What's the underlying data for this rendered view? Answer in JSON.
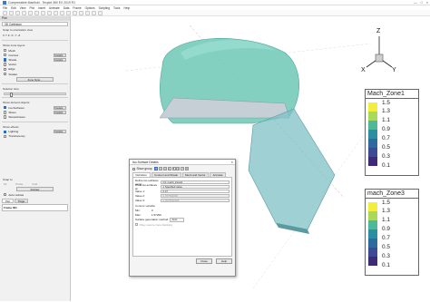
{
  "window": {
    "title": "Compressible Manifold - Tecplot 360 EX 2019 R1",
    "controls": [
      "—",
      "□",
      "×"
    ]
  },
  "menu": [
    "File",
    "Edit",
    "View",
    "Plot",
    "Insert",
    "Animate",
    "Data",
    "Frame",
    "Options",
    "Scripting",
    "Tools",
    "Help"
  ],
  "sidebar": {
    "header": "Plot",
    "plot_type": "3D Cartesian",
    "snap_label": "Snap to orientation view",
    "snap_axes": "X  Y  Z  -X  -Y  -Z",
    "show_zone_layers_label": "Show zone layers",
    "layers": [
      {
        "label": "Mesh",
        "checked": false,
        "details": ""
      },
      {
        "label": "Contour",
        "checked": false,
        "details": "Details..."
      },
      {
        "label": "Shade",
        "checked": true,
        "details": "Details..."
      },
      {
        "label": "Vector",
        "checked": false,
        "details": ""
      },
      {
        "label": "Edge",
        "checked": false,
        "details": ""
      },
      {
        "label": "Scatter",
        "checked": false,
        "details": ""
      }
    ],
    "zone_style_button": "Zone Style...",
    "slider_label": "Solution time",
    "show_derived_label": "Show derived objects",
    "derived": [
      {
        "label": "Iso-Surfaces",
        "checked": true,
        "details": "Details..."
      },
      {
        "label": "Slices",
        "checked": false,
        "details": "Details..."
      },
      {
        "label": "Streamtraces",
        "checked": false,
        "details": ""
      }
    ],
    "show_effects_label": "Show effects",
    "effects": [
      {
        "label": "Lighting",
        "checked": true,
        "details": "Details..."
      },
      {
        "label": "Translucency",
        "checked": false,
        "details": ""
      }
    ],
    "snap_to_label": "Snap to",
    "nav_buttons": [
      "Fit",
      "Probe",
      "Grid"
    ],
    "redraw_button": "Redraw",
    "auto_redraw_label": "Auto redraw",
    "tabs": [
      "Plot",
      "Page"
    ],
    "frame_label": "Frame 001"
  },
  "axes": {
    "x": "X",
    "y": "Y",
    "z": "Z"
  },
  "legends": [
    {
      "title": "Mach_Zone1",
      "ticks": [
        "1.5",
        "1.3",
        "1.1",
        "0.9",
        "0.7",
        "0.5",
        "0.3",
        "0.1"
      ],
      "colors": [
        "#f2ee3c",
        "#a9d95b",
        "#4db89a",
        "#2c8ea3",
        "#2f6a9e",
        "#3e4a93",
        "#3f2a78",
        "#2d0f4e"
      ]
    },
    {
      "title": "mach_Zone3",
      "ticks": [
        "1.5",
        "1.3",
        "1.1",
        "0.9",
        "0.7",
        "0.5",
        "0.3",
        "0.1"
      ],
      "colors": [
        "#f2ee3c",
        "#a9d95b",
        "#4db89a",
        "#2c8ea3",
        "#2f6a9e",
        "#3e4a93",
        "#3f2a78",
        "#2d0f4e"
      ]
    }
  ],
  "dialog": {
    "title": "Iso-Surface Details",
    "close": "×",
    "show_group_label": "Show group",
    "groups": [
      "1",
      "2",
      "3",
      "4",
      "5",
      "6",
      "7",
      "8"
    ],
    "selected_group": "1",
    "tabs": [
      "Definition",
      "Contour and Shade",
      "Mesh and Vector",
      "Animate"
    ],
    "fields": [
      {
        "label": "Define iso-surfaces using:",
        "value": "C1: mach_Zone3",
        "style": "sel"
      },
      {
        "label": "Draw iso-surfaces at:",
        "value": "1 Specified value",
        "style": "sel"
      },
      {
        "label": "Value 1:",
        "value": "0.47",
        "style": ""
      },
      {
        "label": "Value 2:",
        "value": "0.787564958",
        "style": "dis"
      },
      {
        "label": "Value 3:",
        "value": "0.0575632935",
        "style": "dis"
      }
    ],
    "contour_variable_label": "Contour variable",
    "min_label": "Min:",
    "min_value": "0",
    "max_label": "Max:",
    "max_value": "1.57209",
    "surface_gen_label": "Surface generation method:",
    "surface_gen_value": "Auto",
    "obey_label": "Obey source zone blanking",
    "buttons": {
      "close": "Close",
      "help": "Help"
    }
  },
  "colors": {
    "isosurface": "#63c5b4",
    "accent": "#2d6cc0"
  }
}
